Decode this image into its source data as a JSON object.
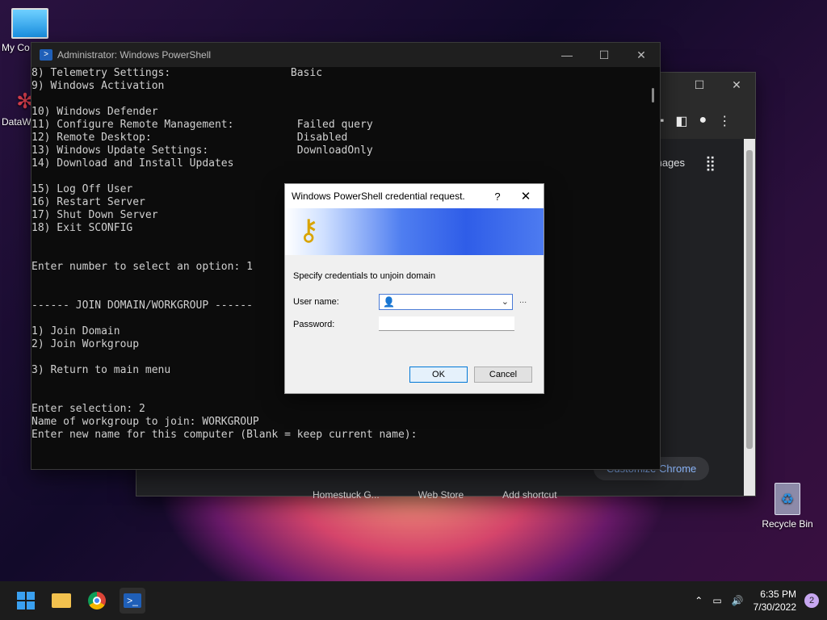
{
  "desktop": {
    "icons": [
      {
        "label": "My Co"
      },
      {
        "label": "DataW"
      },
      {
        "label": "Recycle Bin"
      }
    ]
  },
  "chrome": {
    "images_link": "mages",
    "customize_label": "Customize Chrome",
    "shortcuts": [
      "Homestuck G...",
      "Web Store",
      "Add shortcut"
    ]
  },
  "powershell": {
    "title": "Administrator: Windows PowerShell",
    "lines": [
      "8) Telemetry Settings:                   Basic",
      "9) Windows Activation",
      "",
      "10) Windows Defender",
      "11) Configure Remote Management:          Failed query",
      "12) Remote Desktop:                       Disabled",
      "13) Windows Update Settings:              DownloadOnly",
      "14) Download and Install Updates",
      "",
      "15) Log Off User",
      "16) Restart Server",
      "17) Shut Down Server",
      "18) Exit SCONFIG",
      "",
      "",
      "Enter number to select an option: 1",
      "",
      "",
      "------ JOIN DOMAIN/WORKGROUP ------",
      "",
      "1) Join Domain",
      "2) Join Workgroup",
      "",
      "3) Return to main menu",
      "",
      "",
      "Enter selection: 2",
      "Name of workgroup to join: WORKGROUP",
      "Enter new name for this computer (Blank = keep current name):"
    ]
  },
  "dialog": {
    "title": "Windows PowerShell credential request.",
    "help": "?",
    "close": "✕",
    "prompt": "Specify credentials to unjoin domain",
    "username_label": "User name:",
    "username_value": "",
    "password_label": "Password:",
    "browse": "...",
    "ok_label": "OK",
    "cancel_label": "Cancel"
  },
  "taskbar": {
    "time": "6:35 PM",
    "date": "7/30/2022",
    "notifications": "2"
  }
}
